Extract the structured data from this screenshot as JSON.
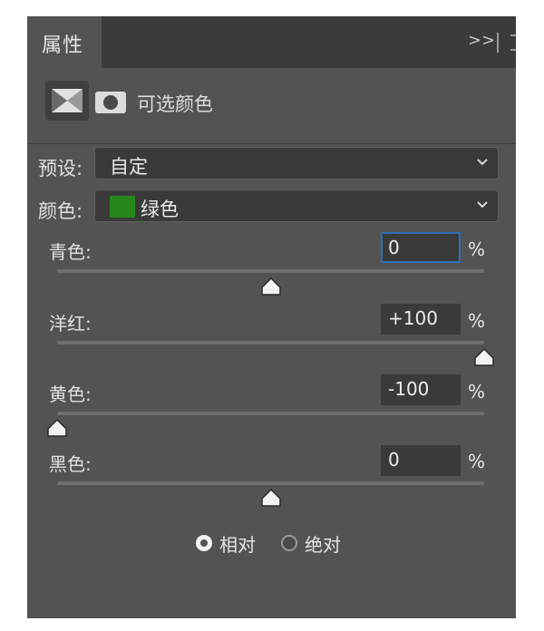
{
  "panel": {
    "tab_label": "属性",
    "tab_menu": ">>",
    "title": "可选颜色"
  },
  "preset": {
    "label": "预设:",
    "value": "自定"
  },
  "color": {
    "label": "颜色:",
    "value": "绿色",
    "swatch": "#24871a"
  },
  "sliders": [
    {
      "label": "青色:",
      "value": "0",
      "percent": 0,
      "unit": "%"
    },
    {
      "label": "洋红:",
      "value": "+100",
      "percent": 100,
      "unit": "%"
    },
    {
      "label": "黄色:",
      "value": "-100",
      "percent": -100,
      "unit": "%"
    },
    {
      "label": "黑色:",
      "value": "0",
      "percent": 0,
      "unit": "%"
    }
  ],
  "method": {
    "options": [
      "相对",
      "绝对"
    ],
    "selected": "相对"
  }
}
